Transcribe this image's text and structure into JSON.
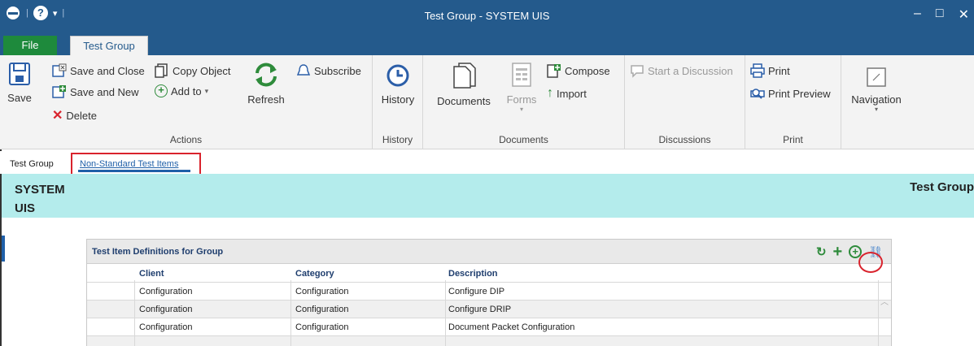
{
  "window": {
    "title": "Test Group - SYSTEM UIS",
    "controls": {
      "minimize": "–",
      "maximize": "□",
      "close": "✕"
    }
  },
  "ribbon_tabs": {
    "file": "File",
    "active": "Test Group"
  },
  "ribbon": {
    "actions": {
      "label": "Actions",
      "save": "Save",
      "save_and_close": "Save and Close",
      "save_and_new": "Save and New",
      "delete": "Delete",
      "copy_object": "Copy Object",
      "add_to": "Add to",
      "refresh": "Refresh",
      "subscribe": "Subscribe"
    },
    "history": {
      "label": "History",
      "history": "History"
    },
    "documents": {
      "label": "Documents",
      "documents": "Documents",
      "forms": "Forms",
      "compose": "Compose",
      "import": "Import"
    },
    "discussions": {
      "label": "Discussions",
      "start": "Start a Discussion"
    },
    "print": {
      "label": "Print",
      "print": "Print",
      "preview": "Print Preview"
    },
    "navigation": {
      "label": "Navigation"
    }
  },
  "subtabs": {
    "test_group": "Test Group",
    "non_standard": "Non-Standard Test Items"
  },
  "banner": {
    "name_line1": "SYSTEM",
    "name_line2": "UIS",
    "type": "Test Group"
  },
  "grid": {
    "title": "Test Item Definitions for Group",
    "columns": [
      "Client",
      "Category",
      "Description"
    ],
    "rows": [
      [
        "Configuration",
        "Configuration",
        "Configure DIP"
      ],
      [
        "Configuration",
        "Configuration",
        "Configure DRIP"
      ],
      [
        "Configuration",
        "Configuration",
        "Document Packet Configuration"
      ]
    ]
  },
  "colors": {
    "titlebar": "#245a8c",
    "file_tab": "#1e8a3c",
    "banner": "#b4ecec",
    "highlight": "#d9232d",
    "tool_green": "#2e8b3b"
  }
}
